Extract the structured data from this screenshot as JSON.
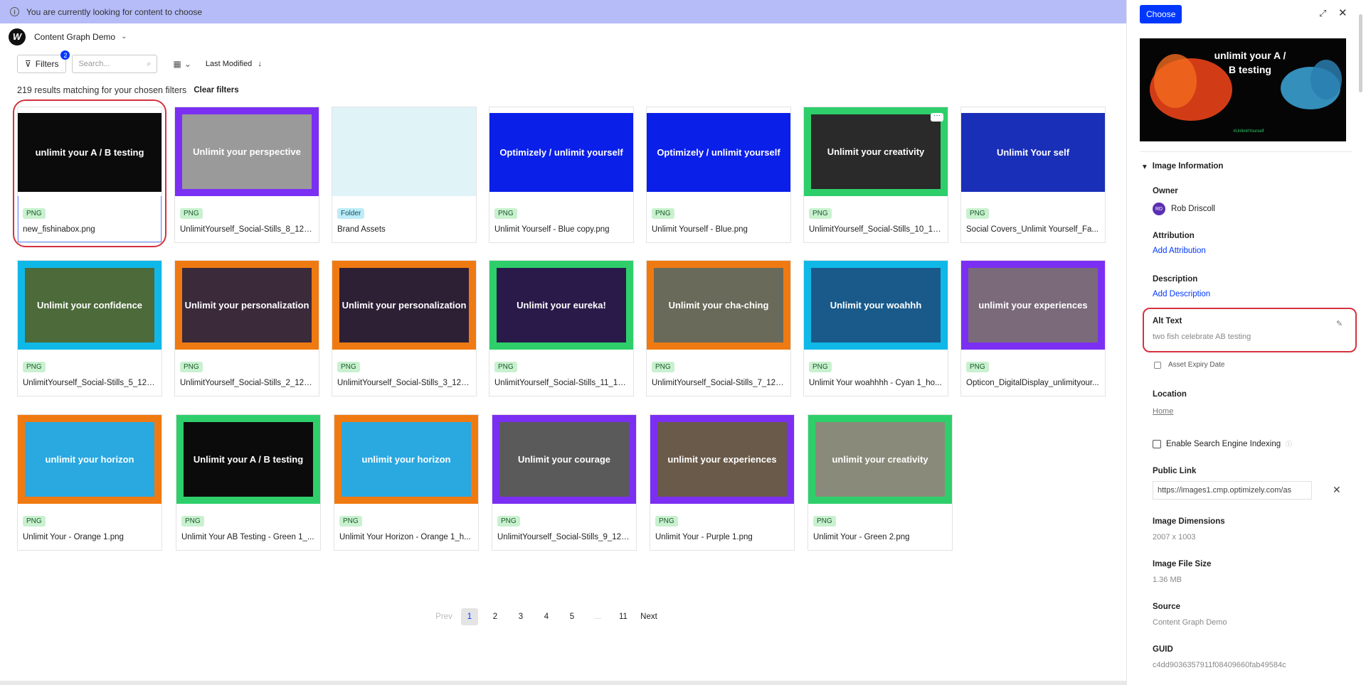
{
  "banner": {
    "text": "You are currently looking for content to choose"
  },
  "header": {
    "workspace": "Content Graph Demo",
    "logo_letter": "W"
  },
  "toolbar": {
    "filters_label": "Filters",
    "filters_count": "2",
    "search_placeholder": "Search...",
    "sort_label": "Last Modified"
  },
  "results": {
    "summary": "219 results matching for your chosen filters",
    "clear_label": "Clear filters"
  },
  "cards": [
    {
      "type": "PNG",
      "name": "new_fishinabox.png",
      "title": "unlimit your A / B testing",
      "bg": "#0b0b0b",
      "frame": "#ffffff"
    },
    {
      "type": "PNG",
      "name": "UnlimitYourself_Social-Stills_8_120...",
      "title": "Unlimit your perspective",
      "bg": "#9a9a9a",
      "frame": "#7b2ff2"
    },
    {
      "type": "Folder",
      "name": "Brand Assets",
      "title": "",
      "bg": "#e0f4f8",
      "frame": "#e0f4f8"
    },
    {
      "type": "PNG",
      "name": "Unlimit Yourself - Blue copy.png",
      "title": "Optimizely / unlimit yourself",
      "bg": "#0a1fe8",
      "frame": "#ffffff"
    },
    {
      "type": "PNG",
      "name": "Unlimit Yourself - Blue.png",
      "title": "Optimizely / unlimit yourself",
      "bg": "#0a1fe8",
      "frame": "#ffffff"
    },
    {
      "type": "PNG",
      "name": "UnlimitYourself_Social-Stills_10_12...",
      "title": "Unlimit your creativity",
      "bg": "#2a2a2a",
      "frame": "#2ecf6b"
    },
    {
      "type": "PNG",
      "name": "Social Covers_Unlimit Yourself_Fa...",
      "title": "Unlimit Your self",
      "bg": "#1a2fb8",
      "frame": "#ffffff"
    },
    {
      "type": "PNG",
      "name": "UnlimitYourself_Social-Stills_5_120...",
      "title": "Unlimit your confidence",
      "bg": "#4d6a3a",
      "frame": "#10b8e8"
    },
    {
      "type": "PNG",
      "name": "UnlimitYourself_Social-Stills_2_120...",
      "title": "Unlimit your personalization",
      "bg": "#3a2a3a",
      "frame": "#f07a12"
    },
    {
      "type": "PNG",
      "name": "UnlimitYourself_Social-Stills_3_120...",
      "title": "Unlimit your personalization",
      "bg": "#2d2035",
      "frame": "#f07a12"
    },
    {
      "type": "PNG",
      "name": "UnlimitYourself_Social-Stills_11_120...",
      "title": "Unlimit your eureka!",
      "bg": "#2a1a4a",
      "frame": "#2ecf6b"
    },
    {
      "type": "PNG",
      "name": "UnlimitYourself_Social-Stills_7_120...",
      "title": "Unlimit your cha-ching",
      "bg": "#6a6a5a",
      "frame": "#f07a12"
    },
    {
      "type": "PNG",
      "name": "Unlimit Your woahhhh - Cyan 1_ho...",
      "title": "Unlimit your woahhh",
      "bg": "#1a5a8a",
      "frame": "#10b8e8"
    },
    {
      "type": "PNG",
      "name": "Opticon_DigitalDisplay_unlimityour...",
      "title": "unlimit your experiences",
      "bg": "#7a6a7a",
      "frame": "#7b2ff2"
    },
    {
      "type": "PNG",
      "name": "Unlimit Your - Orange 1.png",
      "title": "unlimit your horizon",
      "bg": "#2aa8e0",
      "frame": "#f07a12"
    },
    {
      "type": "PNG",
      "name": "Unlimit Your AB Testing - Green 1_...",
      "title": "Unlimit your A / B testing",
      "bg": "#0b0b0b",
      "frame": "#2ecf6b"
    },
    {
      "type": "PNG",
      "name": "Unlimit Your Horizon - Orange 1_h...",
      "title": "unlimit your horizon",
      "bg": "#2aa8e0",
      "frame": "#f07a12"
    },
    {
      "type": "PNG",
      "name": "UnlimitYourself_Social-Stills_9_120...",
      "title": "Unlimit your courage",
      "bg": "#5a5a5a",
      "frame": "#7b2ff2"
    },
    {
      "type": "PNG",
      "name": "Unlimit Your - Purple 1.png",
      "title": "unlimit your experiences",
      "bg": "#6a5a4a",
      "frame": "#7b2ff2"
    },
    {
      "type": "PNG",
      "name": "Unlimit Your - Green 2.png",
      "title": "unlimit your creativity",
      "bg": "#8a8a7a",
      "frame": "#2ecf6b"
    }
  ],
  "pagination": {
    "prev": "Prev",
    "pages": [
      "1",
      "2",
      "3",
      "4",
      "5",
      "...",
      "11"
    ],
    "next": "Next",
    "current": "1"
  },
  "panel": {
    "choose_label": "Choose",
    "preview_title": "unlimit your A / B testing",
    "preview_tag": "#UnlimitYourself",
    "section_title": "Image Information",
    "owner_label": "Owner",
    "owner_initials": "RD",
    "owner_name": "Rob Driscoll",
    "attribution_label": "Attribution",
    "attribution_action": "Add Attribution",
    "description_label": "Description",
    "description_action": "Add Description",
    "alt_label": "Alt Text",
    "alt_value": "two fish celebrate AB testing",
    "expiry_label": "Asset Expiry Date",
    "location_label": "Location",
    "location_value": "Home",
    "indexing_label": "Enable Search Engine Indexing",
    "public_link_label": "Public Link",
    "public_link_value": "https://images1.cmp.optimizely.com/as",
    "dimensions_label": "Image Dimensions",
    "dimensions_value": "2007 x 1003",
    "filesize_label": "Image File Size",
    "filesize_value": "1.36 MB",
    "source_label": "Source",
    "source_value": "Content Graph Demo",
    "guid_label": "GUID",
    "guid_value": "c4dd9036357911f08409660fab49584c"
  },
  "colors": {
    "accent": "#0037ff",
    "highlight": "#d5323e",
    "banner": "#b5bcf7",
    "png_badge": "#c9f1cf",
    "folder_badge": "#bcecf7"
  },
  "icons": [
    "info-icon",
    "chevron-down-icon",
    "filter-icon",
    "search-icon",
    "grid-view-icon",
    "sort-arrow-icon",
    "expand-icon",
    "close-icon",
    "pencil-icon",
    "calendar-icon",
    "help-icon"
  ]
}
